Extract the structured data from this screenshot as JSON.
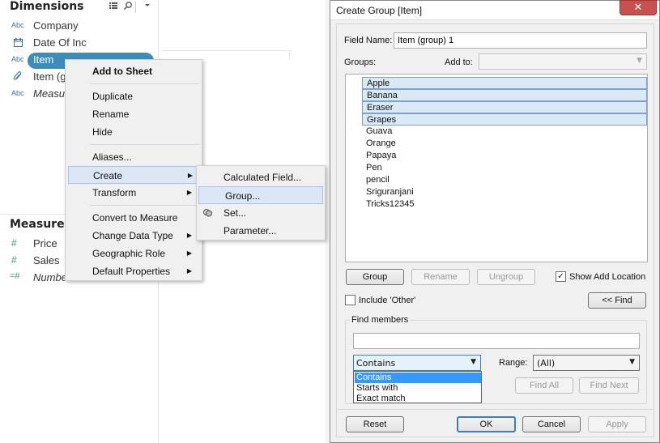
{
  "data_pane": {
    "dimensions_title": "Dimensions",
    "measures_title": "Measures",
    "dimensions": [
      {
        "type": "Abc",
        "name": "Company"
      },
      {
        "type": "date",
        "name": "Date Of Inc"
      },
      {
        "type": "Abc",
        "name": "Item"
      },
      {
        "type": "link",
        "name": "Item (gr"
      },
      {
        "type": "Abc",
        "name": "Measur"
      }
    ],
    "measures": [
      {
        "type": "#",
        "name": "Price"
      },
      {
        "type": "#",
        "name": "Sales"
      },
      {
        "type": "=#",
        "name": "Numbe"
      }
    ]
  },
  "context_menu": {
    "items": [
      "Add to Sheet",
      "Duplicate",
      "Rename",
      "Hide",
      "Aliases...",
      "Create",
      "Transform",
      "Convert to Measure",
      "Change Data Type",
      "Geographic Role",
      "Default Properties"
    ]
  },
  "create_submenu": {
    "items": [
      "Calculated Field...",
      "Group...",
      "Set...",
      "Parameter..."
    ]
  },
  "dialog": {
    "title": "Create Group [Item]",
    "close_label": "✕",
    "field_name_label": "Field Name:",
    "field_name_value": "Item (group) 1",
    "groups_label": "Groups:",
    "add_to_label": "Add to:",
    "add_to_value": "",
    "members": [
      "Apple",
      "Banana",
      "Eraser",
      "Grapes",
      "Guava",
      "Orange",
      "Papaya",
      "Pen",
      "pencil",
      "Sriguranjani",
      "Tricks12345"
    ],
    "selected_members": [
      "Apple",
      "Banana",
      "Eraser",
      "Grapes"
    ],
    "group_button": "Group",
    "rename_button": "Rename",
    "ungroup_button": "Ungroup",
    "show_add_location_label": "Show Add Location",
    "show_add_location_checked": true,
    "include_other_label": "Include 'Other'",
    "include_other_checked": false,
    "find_toggle_button": "<< Find",
    "find_members_label": "Find members",
    "find_value": "",
    "match_mode_value": "Contains",
    "match_mode_options": [
      "Contains",
      "Starts with",
      "Exact match"
    ],
    "range_label": "Range:",
    "range_value": "(All)",
    "find_all_button": "Find All",
    "find_next_button": "Find Next",
    "reset_button": "Reset",
    "ok_button": "OK",
    "cancel_button": "Cancel",
    "apply_button": "Apply"
  }
}
